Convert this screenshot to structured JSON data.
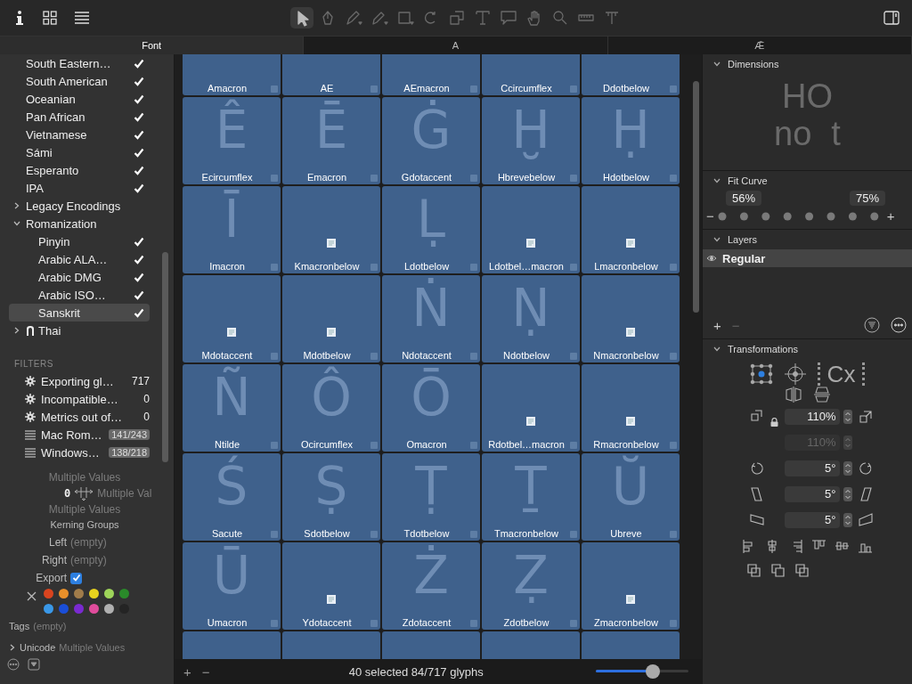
{
  "toolbar": {
    "tools": [
      {
        "kind": "select",
        "selected": true
      },
      {
        "kind": "node",
        "selected": false
      },
      {
        "kind": "pen",
        "selected": false
      },
      {
        "kind": "pencil",
        "selected": false
      },
      {
        "kind": "rectangle",
        "selected": false
      },
      {
        "kind": "rotate",
        "selected": false
      },
      {
        "kind": "scale",
        "selected": false
      },
      {
        "kind": "text",
        "selected": false
      },
      {
        "kind": "annotation",
        "selected": false
      },
      {
        "kind": "hand",
        "selected": false
      },
      {
        "kind": "zoom",
        "selected": false
      },
      {
        "kind": "measure",
        "selected": false
      },
      {
        "kind": "metrics",
        "selected": false
      }
    ]
  },
  "tabs": [
    {
      "label": "Font",
      "selected": true
    },
    {
      "label": "A",
      "selected": false
    },
    {
      "label": "Ǣ",
      "selected": false
    }
  ],
  "sidebar": {
    "tree": [
      {
        "children": [
          {
            "label": "South Eastern…",
            "checked": true,
            "selected": false
          },
          {
            "label": "South American",
            "checked": true,
            "selected": false
          },
          {
            "label": "Oceanian",
            "checked": true,
            "selected": false
          },
          {
            "label": "Pan African",
            "checked": true,
            "selected": false
          },
          {
            "label": "Vietnamese",
            "checked": true,
            "selected": false
          },
          {
            "label": "Sámi",
            "checked": true,
            "selected": false
          },
          {
            "label": "Esperanto",
            "checked": true,
            "selected": false
          },
          {
            "label": "IPA",
            "checked": true,
            "selected": false
          },
          {
            "label": "Legacy Encodings",
            "checked": false,
            "selected": false,
            "expanded": false
          },
          {
            "label": "Romanization",
            "checked": false,
            "selected": false,
            "expanded": true,
            "children": [
              {
                "label": "Pinyin",
                "checked": true,
                "selected": false
              },
              {
                "label": "Arabic ALA…",
                "checked": true,
                "selected": false
              },
              {
                "label": "Arabic DMG",
                "checked": true,
                "selected": false
              },
              {
                "label": "Arabic ISO…",
                "checked": true,
                "selected": false
              },
              {
                "label": "Sanskrit",
                "checked": true,
                "selected": true
              }
            ]
          }
        ]
      },
      {
        "label": "Thai",
        "checked": false,
        "selected": false,
        "expanded": false,
        "kind": "script"
      }
    ],
    "filters_title": "FILTERS",
    "filters": [
      {
        "kind": "smart",
        "label": "Exporting gl…",
        "count": "717"
      },
      {
        "kind": "smart",
        "label": "Incompatible…",
        "count": "0"
      },
      {
        "kind": "smart",
        "label": "Metrics out of…",
        "count": "0"
      },
      {
        "kind": "list",
        "label": "Mac Rom…",
        "count": "141/243"
      },
      {
        "kind": "list",
        "label": "Windows…",
        "count": "138/218"
      }
    ]
  },
  "info": {
    "width_label": "Multiple Values",
    "metrics_value": "0",
    "metrics_label": "Multiple Val",
    "height_label": "Multiple Values",
    "kerning_title": "Kerning Groups",
    "left_label": "Left",
    "left_value": "(empty)",
    "right_label": "Right",
    "right_value": "(empty)",
    "export_label": "Export",
    "export_checked": true,
    "colors": [
      {
        "color": "#d9441f"
      },
      {
        "color": "#e8902a"
      },
      {
        "color": "#a07c4a"
      },
      {
        "color": "#e8d21e"
      },
      {
        "color": "#9ed45a"
      },
      {
        "color": "#2a8a2a"
      },
      {
        "color": "#3a98e8"
      },
      {
        "color": "#1a4ed8"
      },
      {
        "color": "#7a2ad0"
      },
      {
        "color": "#e04c9c"
      },
      {
        "color": "#b0b0b0"
      },
      {
        "color": "#242424"
      }
    ],
    "tags_label": "Tags",
    "tags_value": "(empty)",
    "unicode_label": "Unicode",
    "unicode_value": "Multiple Values"
  },
  "grid": {
    "rows": [
      {
        "cells": [
          {
            "kind": "cut",
            "name": "Amacron",
            "selected": true
          },
          {
            "kind": "cut",
            "name": "AE",
            "selected": true
          },
          {
            "kind": "cut",
            "name": "AEmacron",
            "selected": true
          },
          {
            "kind": "cut",
            "name": "Ccircumflex",
            "selected": true
          },
          {
            "kind": "cut",
            "name": "Ddotbelow",
            "selected": true
          }
        ]
      },
      {
        "cells": [
          {
            "kind": "glyph",
            "glyph": "Ê",
            "name": "Ecircumflex",
            "selected": true
          },
          {
            "kind": "glyph",
            "glyph": "Ē",
            "name": "Emacron",
            "selected": true
          },
          {
            "kind": "glyph",
            "glyph": "Ġ",
            "name": "Gdotaccent",
            "selected": true
          },
          {
            "kind": "glyph",
            "glyph": "Ḫ",
            "name": "Hbrevebelow",
            "selected": true
          },
          {
            "kind": "glyph",
            "glyph": "Ḥ",
            "name": "Hdotbelow",
            "selected": true
          }
        ]
      },
      {
        "cells": [
          {
            "kind": "glyph",
            "glyph": "Ī",
            "name": "Imacron",
            "selected": true
          },
          {
            "kind": "empty",
            "name": "Kmacronbelow",
            "selected": true
          },
          {
            "kind": "glyph",
            "glyph": "Ḷ",
            "name": "Ldotbelow",
            "selected": true
          },
          {
            "kind": "empty",
            "name": "Ldotbel…macron",
            "selected": true
          },
          {
            "kind": "empty",
            "name": "Lmacronbelow",
            "selected": true
          }
        ]
      },
      {
        "cells": [
          {
            "kind": "empty",
            "name": "Mdotaccent",
            "selected": true
          },
          {
            "kind": "empty",
            "name": "Mdotbelow",
            "selected": true
          },
          {
            "kind": "glyph",
            "glyph": "Ṅ",
            "name": "Ndotaccent",
            "selected": true
          },
          {
            "kind": "glyph",
            "glyph": "Ṇ",
            "name": "Ndotbelow",
            "selected": true
          },
          {
            "kind": "empty",
            "name": "Nmacronbelow",
            "selected": true
          }
        ]
      },
      {
        "cells": [
          {
            "kind": "glyph",
            "glyph": "Ñ",
            "name": "Ntilde",
            "selected": true
          },
          {
            "kind": "glyph",
            "glyph": "Ô",
            "name": "Ocircumflex",
            "selected": true
          },
          {
            "kind": "glyph",
            "glyph": "Ō",
            "name": "Omacron",
            "selected": true
          },
          {
            "kind": "empty",
            "name": "Rdotbel…macron",
            "selected": true
          },
          {
            "kind": "empty",
            "name": "Rmacronbelow",
            "selected": true
          }
        ]
      },
      {
        "cells": [
          {
            "kind": "glyph",
            "glyph": "Ś",
            "name": "Sacute",
            "selected": true
          },
          {
            "kind": "glyph",
            "glyph": "Ṣ",
            "name": "Sdotbelow",
            "selected": true
          },
          {
            "kind": "glyph",
            "glyph": "Ṭ",
            "name": "Tdotbelow",
            "selected": true
          },
          {
            "kind": "glyph",
            "glyph": "Ṯ",
            "name": "Tmacronbelow",
            "selected": true
          },
          {
            "kind": "glyph",
            "glyph": "Ŭ",
            "name": "Ubreve",
            "selected": true
          }
        ]
      },
      {
        "cells": [
          {
            "kind": "glyph",
            "glyph": "Ū",
            "name": "Umacron",
            "selected": true
          },
          {
            "kind": "empty",
            "name": "Ydotaccent",
            "selected": true
          },
          {
            "kind": "glyph",
            "glyph": "Ż",
            "name": "Zdotaccent",
            "selected": true
          },
          {
            "kind": "glyph",
            "glyph": "Ẓ",
            "name": "Zdotbelow",
            "selected": true
          },
          {
            "kind": "empty",
            "name": "Zmacronbelow",
            "selected": true
          }
        ]
      },
      {
        "cells": [
          {
            "kind": "blank",
            "selected": true
          },
          {
            "kind": "blank",
            "selected": true
          },
          {
            "kind": "blank",
            "selected": true
          },
          {
            "kind": "blank",
            "selected": true
          },
          {
            "kind": "blank",
            "selected": true
          }
        ]
      }
    ]
  },
  "status": {
    "add": "+",
    "remove": "−",
    "text": "40 selected 84/717 glyphs",
    "zoom": {
      "level": 0.62
    }
  },
  "panel": {
    "dimensions": {
      "title": "Dimensions",
      "expanded": true,
      "sample_top": "HO",
      "sample_bottom": "no",
      "sample_t": "t"
    },
    "fit_curve": {
      "title": "Fit Curve",
      "expanded": true,
      "low": "56%",
      "high": "75%",
      "minus": "−",
      "plus": "+"
    },
    "layers": {
      "title": "Layers",
      "expanded": true,
      "items": [
        {
          "label": "Regular",
          "selected": true
        }
      ],
      "add": "+",
      "remove": "−"
    },
    "transformations": {
      "title": "Transformations",
      "expanded": true,
      "center_label": "Cx",
      "fields": [
        {
          "kind": "scale",
          "value": "110%",
          "disabled": false
        },
        {
          "kind": "scale-v",
          "value": "110%",
          "disabled": true
        },
        {
          "kind": "rotate",
          "value": "5°",
          "disabled": false
        },
        {
          "kind": "slant-h",
          "value": "5°",
          "disabled": false
        },
        {
          "kind": "slant-v",
          "value": "5°",
          "disabled": false
        }
      ]
    }
  }
}
